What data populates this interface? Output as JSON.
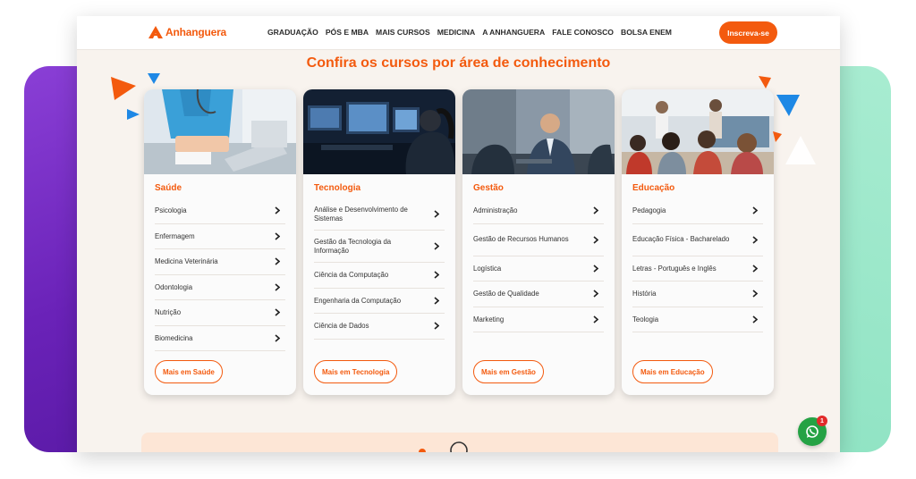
{
  "header": {
    "logo_text": "Anhanguera",
    "nav": [
      "GRADUAÇÃO",
      "PÓS E MBA",
      "MAIS CURSOS",
      "MEDICINA",
      "A ANHANGUERA",
      "FALE CONOSCO",
      "BOLSA ENEM"
    ],
    "cta_label": "Inscreva-se"
  },
  "main": {
    "title": "Confira os cursos por área de conhecimento",
    "cards": [
      {
        "title": "Saúde",
        "image": "nurse-with-laptop",
        "courses": [
          "Psicologia",
          "Enfermagem",
          "Medicina Veterinária",
          "Odontologia",
          "Nutrição",
          "Biomedicina"
        ],
        "button": "Mais em Saúde"
      },
      {
        "title": "Tecnologia",
        "image": "monitors-programmers",
        "courses": [
          "Análise e Desenvolvimento de Sistemas",
          "Gestão da Tecnologia da Informação",
          "Ciência da Computação",
          "Engenharia da Computação",
          "Ciência de Dados"
        ],
        "button": "Mais em Tecnologia"
      },
      {
        "title": "Gestão",
        "image": "business-meeting",
        "courses": [
          "Administração",
          "Gestão de Recursos Humanos",
          "Logística",
          "Gestão de Qualidade",
          "Marketing"
        ],
        "button": "Mais em Gestão"
      },
      {
        "title": "Educação",
        "image": "classroom-children",
        "courses": [
          "Pedagogia",
          "Educação Física - Bacharelado",
          "Letras - Português e Inglês",
          "História",
          "Teologia"
        ],
        "button": "Mais em Educação"
      }
    ]
  },
  "whatsapp": {
    "badge": "1",
    "icon": "whatsapp-icon"
  },
  "colors": {
    "brand": "#f35a0e",
    "whatsapp": "#25a244",
    "purple": "#6a22b8",
    "mint": "#8fe3c3",
    "accent_blue": "#1e88e5"
  }
}
